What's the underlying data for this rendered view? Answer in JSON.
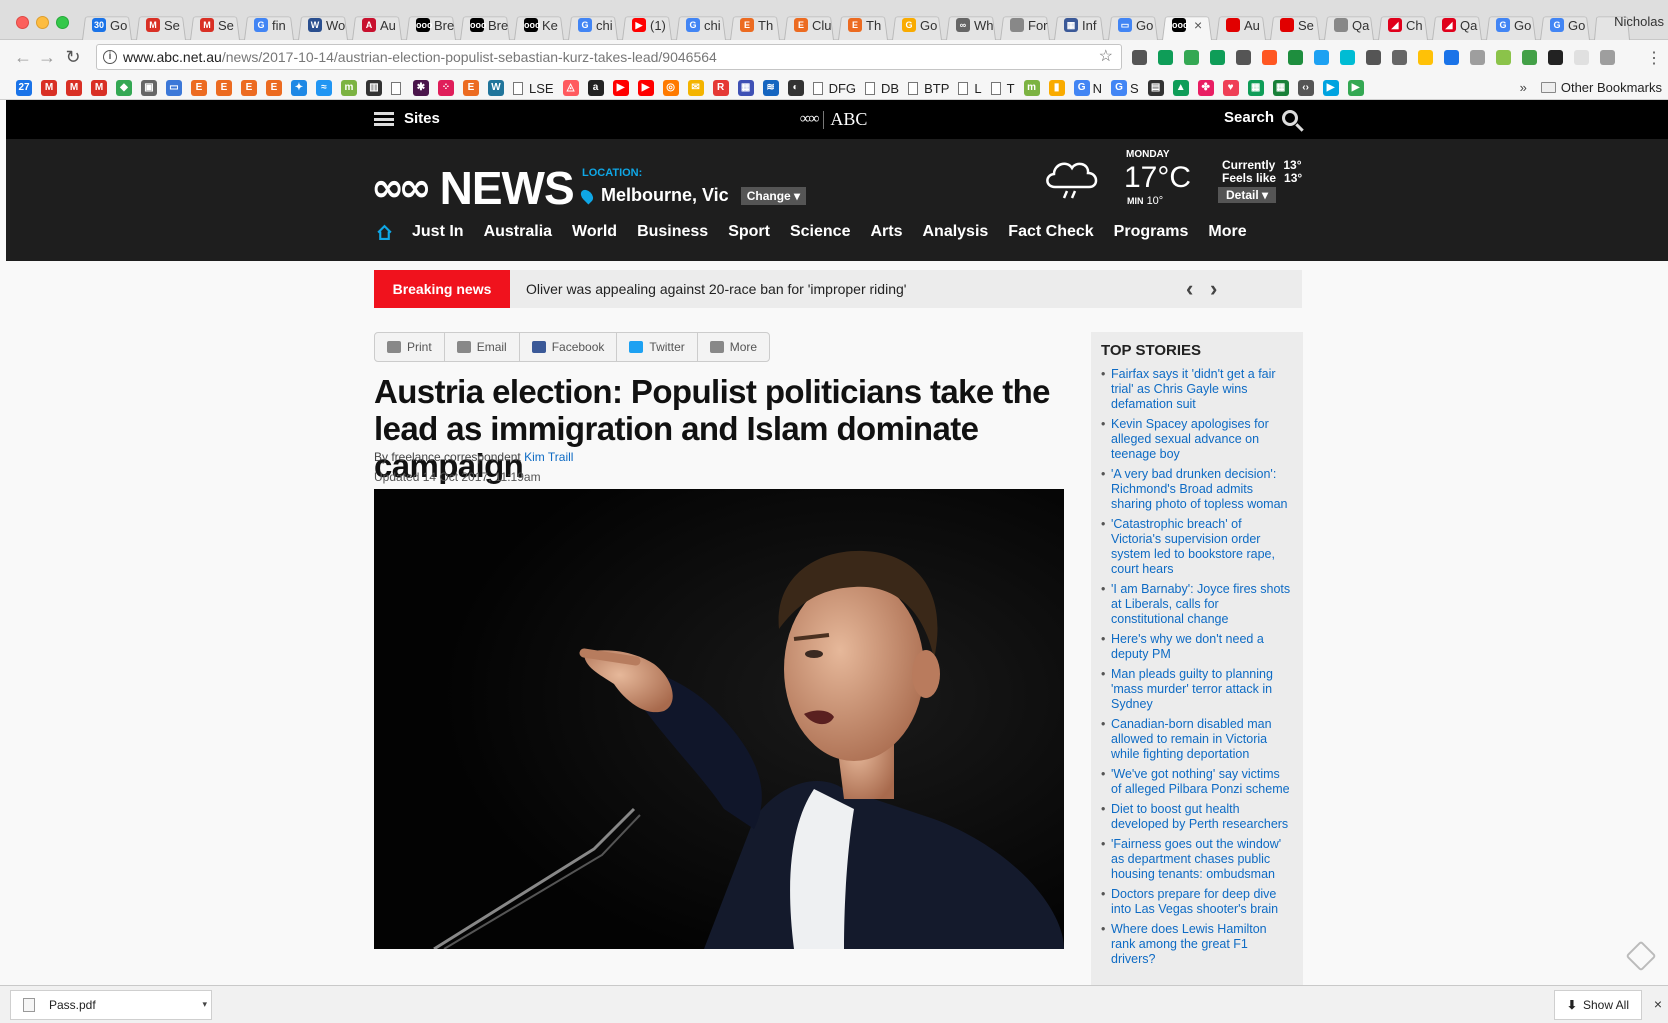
{
  "browser": {
    "tabs": [
      {
        "label": "Go",
        "icon": "calendar-icon",
        "color": "#1a73e8",
        "glyph": "30"
      },
      {
        "label": "Se",
        "icon": "gmail-icon",
        "color": "#d93025",
        "glyph": "M"
      },
      {
        "label": "Se",
        "icon": "gmail-icon",
        "color": "#d93025",
        "glyph": "M"
      },
      {
        "label": "fin",
        "icon": "google-icon",
        "color": "#4285f4",
        "glyph": "G"
      },
      {
        "label": "Wo",
        "icon": "globe-icon",
        "color": "#2a4f8f",
        "glyph": "W"
      },
      {
        "label": "Au",
        "icon": "shield-icon",
        "color": "#c8102e",
        "glyph": "A"
      },
      {
        "label": "Bre",
        "icon": "abc-icon",
        "color": "#000000",
        "glyph": "ooo"
      },
      {
        "label": "Bre",
        "icon": "abc-icon",
        "color": "#000000",
        "glyph": "ooo"
      },
      {
        "label": "Ke",
        "icon": "abc-icon",
        "color": "#000000",
        "glyph": "ooo"
      },
      {
        "label": "chi",
        "icon": "google-icon",
        "color": "#4285f4",
        "glyph": "G"
      },
      {
        "label": "(1)",
        "icon": "youtube-icon",
        "color": "#ff0000",
        "glyph": "▶"
      },
      {
        "label": "chi",
        "icon": "google-icon",
        "color": "#4285f4",
        "glyph": "G"
      },
      {
        "label": "Th",
        "icon": "e-icon",
        "color": "#ec6b21",
        "glyph": "E"
      },
      {
        "label": "Clu",
        "icon": "e-icon",
        "color": "#ec6b21",
        "glyph": "E"
      },
      {
        "label": "Th",
        "icon": "e-icon",
        "color": "#ec6b21",
        "glyph": "E"
      },
      {
        "label": "Go",
        "icon": "keep-icon",
        "color": "#f9ab00",
        "glyph": "G"
      },
      {
        "label": "Wh",
        "icon": "link-icon",
        "color": "#666666",
        "glyph": "∞"
      },
      {
        "label": "For",
        "icon": "doc-icon",
        "color": "#888888",
        "glyph": ""
      },
      {
        "label": "Inf",
        "icon": "grid-icon",
        "color": "#3b5998",
        "glyph": "▦"
      },
      {
        "label": "Go",
        "icon": "slides-icon",
        "color": "#4285f4",
        "glyph": "▭"
      },
      {
        "label": "",
        "icon": "abc-icon",
        "color": "#000000",
        "glyph": "ooo",
        "active": true,
        "close": "×"
      },
      {
        "label": "Au",
        "icon": "red-icon",
        "color": "#e10000",
        "glyph": ""
      },
      {
        "label": "Se",
        "icon": "red-icon",
        "color": "#e10000",
        "glyph": ""
      },
      {
        "label": "Qa",
        "icon": "doc-icon",
        "color": "#888888",
        "glyph": ""
      },
      {
        "label": "Ch",
        "icon": "qantas-icon",
        "color": "#e0001b",
        "glyph": "◢"
      },
      {
        "label": "Qa",
        "icon": "qantas-icon",
        "color": "#e0001b",
        "glyph": "◢"
      },
      {
        "label": "Go",
        "icon": "translate-icon",
        "color": "#4285f4",
        "glyph": "G"
      },
      {
        "label": "Go",
        "icon": "translate-icon",
        "color": "#4285f4",
        "glyph": "G"
      }
    ],
    "profile_name": "Nicholas",
    "url_host": "www.abc.net.au",
    "url_path": "/news/2017-10-14/austrian-election-populist-sebastian-kurz-takes-lead/9046564",
    "bookmarks": [
      {
        "label": "",
        "icon": "calendar-icon",
        "color": "#1a73e8",
        "glyph": "27"
      },
      {
        "label": "",
        "icon": "gmail-icon",
        "color": "#d93025",
        "glyph": "M"
      },
      {
        "label": "",
        "icon": "gmail-icon",
        "color": "#d93025",
        "glyph": "M"
      },
      {
        "label": "",
        "icon": "gmail-icon",
        "color": "#d93025",
        "glyph": "M"
      },
      {
        "label": "",
        "icon": "maps-icon",
        "color": "#34a853",
        "glyph": "◆"
      },
      {
        "label": "",
        "icon": "photo-icon",
        "color": "#666666",
        "glyph": "▣"
      },
      {
        "label": "",
        "icon": "card-icon",
        "color": "#3c78d8",
        "glyph": "▭"
      },
      {
        "label": "",
        "icon": "e-icon",
        "color": "#ec6b21",
        "glyph": "E"
      },
      {
        "label": "",
        "icon": "e-icon",
        "color": "#ec6b21",
        "glyph": "E"
      },
      {
        "label": "",
        "icon": "e-icon",
        "color": "#ec6b21",
        "glyph": "E"
      },
      {
        "label": "",
        "icon": "e-icon",
        "color": "#ec6b21",
        "glyph": "E"
      },
      {
        "label": "",
        "icon": "puzzle-icon",
        "color": "#1e88e5",
        "glyph": "✦"
      },
      {
        "label": "",
        "icon": "wave-icon",
        "color": "#2196f3",
        "glyph": "≈"
      },
      {
        "label": "",
        "icon": "leaf-icon",
        "color": "#7cb342",
        "glyph": "m"
      },
      {
        "label": "",
        "icon": "building-icon",
        "color": "#333333",
        "glyph": "▥"
      },
      {
        "label": "",
        "icon": "doc-icon",
        "color": "#ffffff",
        "glyph": ""
      },
      {
        "label": "",
        "icon": "slack-icon",
        "color": "#4a154b",
        "glyph": "✱"
      },
      {
        "label": "",
        "icon": "dots-icon",
        "color": "#e01e5a",
        "glyph": "⁘"
      },
      {
        "label": "",
        "icon": "e-icon",
        "color": "#ec6b21",
        "glyph": "E"
      },
      {
        "label": "",
        "icon": "wordpress-icon",
        "color": "#21759b",
        "glyph": "W"
      },
      {
        "label": "LSE",
        "icon": "doc-icon",
        "color": "#ffffff",
        "glyph": ""
      },
      {
        "label": "",
        "icon": "airbnb-icon",
        "color": "#ff5a5f",
        "glyph": "◬"
      },
      {
        "label": "",
        "icon": "amazon-icon",
        "color": "#222222",
        "glyph": "a"
      },
      {
        "label": "",
        "icon": "youtube-icon",
        "color": "#ff0000",
        "glyph": "▶"
      },
      {
        "label": "",
        "icon": "youtube-icon",
        "color": "#ff0000",
        "glyph": "▶"
      },
      {
        "label": "",
        "icon": "target-icon",
        "color": "#ff7a00",
        "glyph": "◎"
      },
      {
        "label": "",
        "icon": "mail-icon",
        "color": "#f4b400",
        "glyph": "✉"
      },
      {
        "label": "",
        "icon": "r-icon",
        "color": "#e53935",
        "glyph": "R"
      },
      {
        "label": "",
        "icon": "table-icon",
        "color": "#3f51b5",
        "glyph": "▦"
      },
      {
        "label": "",
        "icon": "wave-icon",
        "color": "#1565c0",
        "glyph": "≋"
      },
      {
        "label": "",
        "icon": "moon-icon",
        "color": "#333333",
        "glyph": "◐"
      },
      {
        "label": "DFG",
        "icon": "doc-icon",
        "color": "#ffffff",
        "glyph": ""
      },
      {
        "label": "DB",
        "icon": "doc-icon",
        "color": "#ffffff",
        "glyph": ""
      },
      {
        "label": "BTP",
        "icon": "doc-icon",
        "color": "#ffffff",
        "glyph": ""
      },
      {
        "label": "L",
        "icon": "doc-icon",
        "color": "#ffffff",
        "glyph": ""
      },
      {
        "label": "T",
        "icon": "doc-icon",
        "color": "#ffffff",
        "glyph": ""
      },
      {
        "label": "",
        "icon": "leaf-icon",
        "color": "#7cb342",
        "glyph": "m"
      },
      {
        "label": "",
        "icon": "keep-icon",
        "color": "#f9ab00",
        "glyph": "▮"
      },
      {
        "label": "N",
        "icon": "google-icon",
        "color": "#4285f4",
        "glyph": "G"
      },
      {
        "label": "S",
        "icon": "google-icon",
        "color": "#4285f4",
        "glyph": "G"
      },
      {
        "label": "",
        "icon": "grid-icon",
        "color": "#333333",
        "glyph": "▤"
      },
      {
        "label": "",
        "icon": "drive-icon",
        "color": "#0f9d58",
        "glyph": "▲"
      },
      {
        "label": "",
        "icon": "pinwheel-icon",
        "color": "#e91e63",
        "glyph": "✤"
      },
      {
        "label": "",
        "icon": "pocket-icon",
        "color": "#ef3f56",
        "glyph": "♥"
      },
      {
        "label": "",
        "icon": "sheets-icon",
        "color": "#0f9d58",
        "glyph": "▦"
      },
      {
        "label": "",
        "icon": "sheets-icon",
        "color": "#188038",
        "glyph": "▦"
      },
      {
        "label": "",
        "icon": "code-icon",
        "color": "#555555",
        "glyph": "‹›"
      },
      {
        "label": "",
        "icon": "play-icon",
        "color": "#00a3e0",
        "glyph": "▶"
      },
      {
        "label": "",
        "icon": "play-icon",
        "color": "#34a853",
        "glyph": "▶"
      }
    ],
    "bookmarks_overflow": "»",
    "other_bookmarks": "Other Bookmarks",
    "extension_colors": [
      "#555555",
      "#0f9d58",
      "#34a853",
      "#0f9d58",
      "#555555",
      "#ff5722",
      "#1e8e3e",
      "#1da1f2",
      "#00bcd4",
      "#555555",
      "#666666",
      "#ffc107",
      "#1a73e8",
      "#9e9e9e",
      "#8bc34a",
      "#43a047",
      "#222222",
      "#e0e0e0",
      "#9e9e9e"
    ]
  },
  "abc": {
    "sites_label": "Sites",
    "brand": "ABC",
    "search_label": "Search",
    "news_wordmark": "NEWS",
    "location_label": "LOCATION:",
    "location_city": "Melbourne, Vic",
    "change_label": "Change ▾",
    "weather": {
      "day": "MONDAY",
      "temp": "17°C",
      "min_label": "MIN",
      "min_value": "10°",
      "currently_label": "Currently",
      "currently_value": "13°",
      "feels_label": "Feels like",
      "feels_value": "13°",
      "detail_label": "Detail ▾"
    },
    "nav": [
      "Just In",
      "Australia",
      "World",
      "Business",
      "Sport",
      "Science",
      "Arts",
      "Analysis",
      "Fact Check",
      "Programs",
      "More"
    ],
    "breaking_label": "Breaking news",
    "breaking_text": "Oliver was appealing against 20-race ban for 'improper riding'",
    "share": [
      "Print",
      "Email",
      "Facebook",
      "Twitter",
      "More"
    ],
    "headline": "Austria election: Populist politicians take the lead as immigration and Islam dominate campaign",
    "byline_prefix": "By freelance correspondent",
    "author": "Kim Traill",
    "updated": "Updated 14 Oct 2017, 11:19am",
    "top_stories_title": "TOP STORIES",
    "top_stories": [
      "Fairfax says it 'didn't get a fair trial' as Chris Gayle wins defamation suit",
      "Kevin Spacey apologises for alleged sexual advance on teenage boy",
      "'A very bad drunken decision': Richmond's Broad admits sharing photo of topless woman",
      "'Catastrophic breach' of Victoria's supervision order system led to bookstore rape, court hears",
      "'I am Barnaby': Joyce fires shots at Liberals, calls for constitutional change",
      "Here's why we don't need a deputy PM",
      "Man pleads guilty to planning 'mass murder' terror attack in Sydney",
      "Canadian-born disabled man allowed to remain in Victoria while fighting deportation",
      "'We've got nothing' say victims of alleged Pilbara Ponzi scheme",
      "Diet to boost gut health developed by Perth researchers",
      "'Fairness goes out the window' as department chases public housing tenants: ombudsman",
      "Doctors prepare for deep dive into Las Vegas shooter's brain",
      "Where does Lewis Hamilton rank among the great F1 drivers?"
    ]
  },
  "downloads": {
    "file": "Pass.pdf",
    "show_all": "Show All",
    "close": "×"
  }
}
